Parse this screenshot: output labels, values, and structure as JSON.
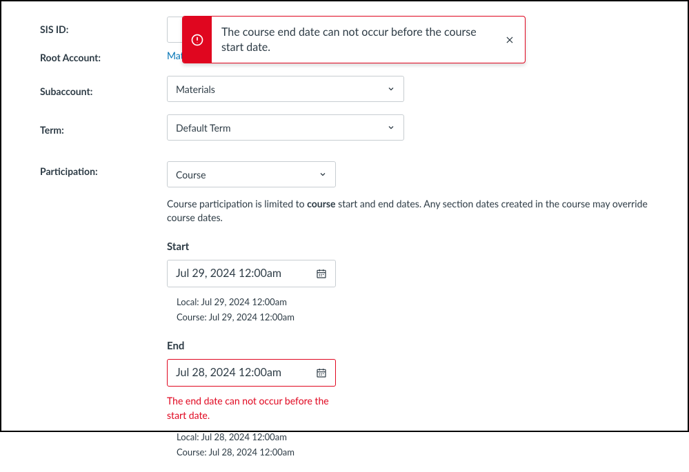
{
  "alert": {
    "message": "The course end date can not occur before the course start date."
  },
  "labels": {
    "sis_id": "SIS ID:",
    "root_account": "Root Account:",
    "subaccount": "Subaccount:",
    "term": "Term:",
    "participation": "Participation:"
  },
  "root_account": {
    "link": "Materials"
  },
  "subaccount": {
    "value": "Materials"
  },
  "term": {
    "value": "Default Term"
  },
  "participation": {
    "value": "Course",
    "hint_before": "Course participation is limited to ",
    "hint_bold": "course",
    "hint_after": " start and end dates. Any section dates created in the course may override course dates."
  },
  "start": {
    "label": "Start",
    "value": "Jul 29, 2024 12:00am",
    "local_label": "Local: ",
    "local_value": "Jul 29, 2024 12:00am",
    "course_label": "Course: ",
    "course_value": "Jul 29, 2024 12:00am"
  },
  "end": {
    "label": "End",
    "value": "Jul 28, 2024 12:00am",
    "error": "The end date can not occur before the start date.",
    "local_label": "Local: ",
    "local_value": "Jul 28, 2024 12:00am",
    "course_label": "Course: ",
    "course_value": "Jul 28, 2024 12:00am"
  }
}
